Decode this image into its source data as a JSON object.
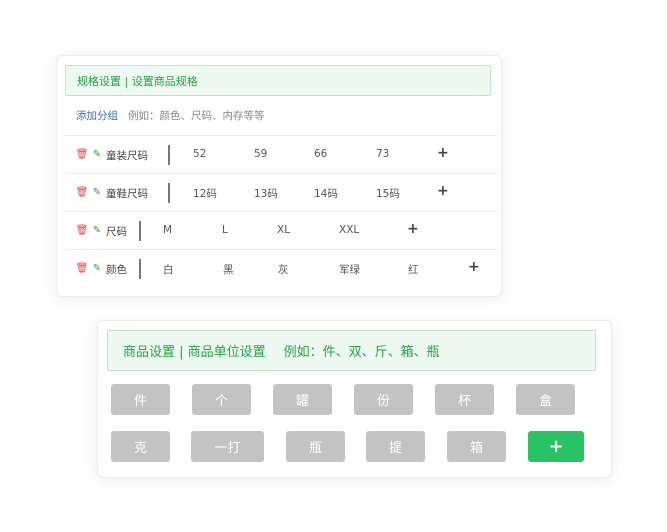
{
  "spec_panel": {
    "banner": "规格设置 | 设置商品规格",
    "add_group_label": "添加分组",
    "add_group_hint": "例如：颜色、尺码、内存等等",
    "groups": [
      {
        "name": "童装尺码",
        "values": [
          "52",
          "59",
          "66",
          "73"
        ]
      },
      {
        "name": "童鞋尺码",
        "values": [
          "12码",
          "13码",
          "14码",
          "15码"
        ]
      },
      {
        "name": "尺码",
        "values": [
          "M",
          "L",
          "XL",
          "XXL"
        ]
      },
      {
        "name": "颜色",
        "values": [
          "白",
          "黑",
          "灰",
          "军绿",
          "红"
        ]
      }
    ],
    "icons": {
      "delete": "trash-icon",
      "edit": "pencil-icon",
      "add": "plus-icon"
    },
    "colors": {
      "delete": "#e8483c",
      "edit": "#3a9a2a",
      "banner_text": "#24a148",
      "link": "#2f6fb5"
    }
  },
  "unit_panel": {
    "banner_title": "商品设置 | 商品单位设置",
    "banner_example": "例如：件、双、斤、箱、瓶",
    "units": [
      "件",
      "个",
      "罐",
      "份",
      "杯",
      "盒",
      "克",
      "一打",
      "瓶",
      "提",
      "箱"
    ],
    "add_icon": "plus-icon",
    "colors": {
      "unit_bg": "#c3c3c3",
      "add_bg": "#27c365",
      "banner_text": "#24a148"
    }
  }
}
